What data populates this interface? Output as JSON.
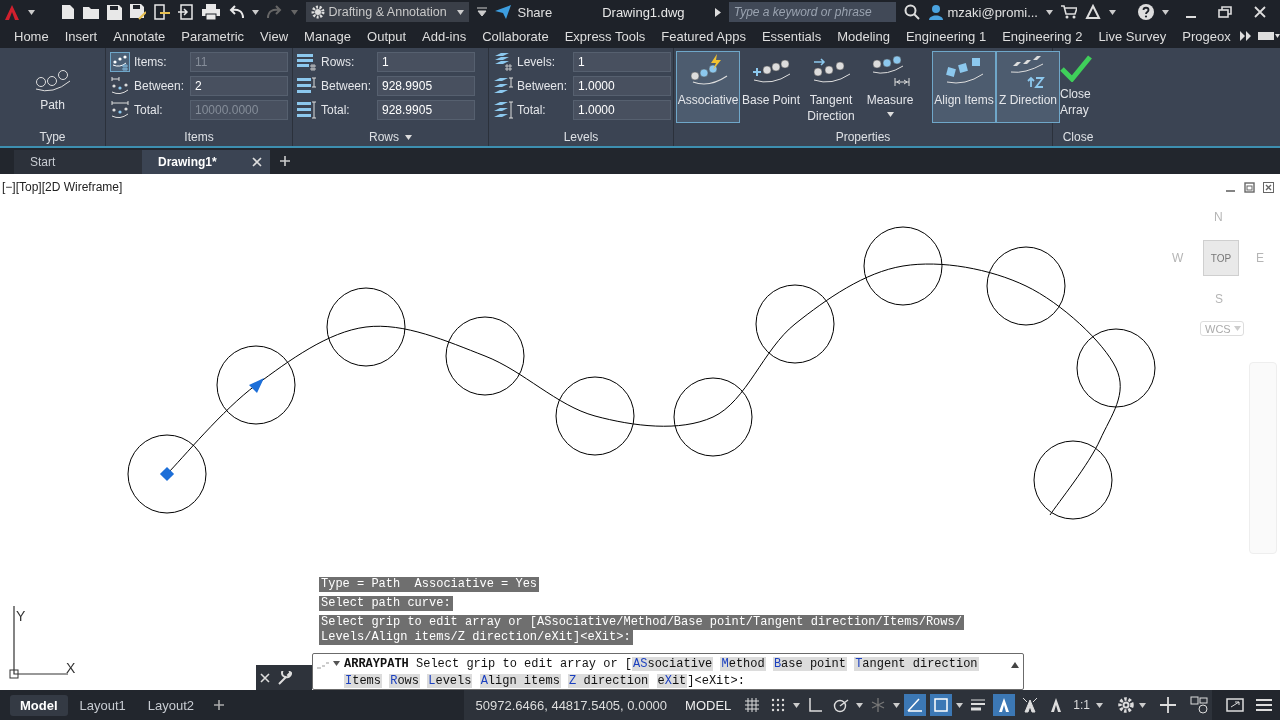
{
  "title_bar": {
    "workspace": "Drafting & Annotation",
    "share": "Share",
    "file": "Drawing1.dwg",
    "search": {
      "placeholder": "Type a keyword or phrase"
    },
    "user": "mzaki@promi..."
  },
  "menu_tabs": [
    "Home",
    "Insert",
    "Annotate",
    "Parametric",
    "View",
    "Manage",
    "Output",
    "Add-ins",
    "Collaborate",
    "Express Tools",
    "Featured Apps",
    "Essentials",
    "Modeling",
    "Engineering 1",
    "Engineering 2",
    "Live Survey",
    "Progeox"
  ],
  "ribbon": {
    "type_panel": {
      "button": "Path",
      "title": "Type"
    },
    "items_panel": {
      "title": "Items",
      "fields": [
        {
          "label": "Items:",
          "value": "11",
          "disabled": true
        },
        {
          "label": "Between:",
          "value": "2",
          "disabled": false
        },
        {
          "label": "Total:",
          "value": "10000.0000",
          "disabled": true
        }
      ]
    },
    "rows_panel": {
      "title": "Rows",
      "fields": [
        {
          "label": "Rows:",
          "value": "1"
        },
        {
          "label": "Between:",
          "value": "928.9905"
        },
        {
          "label": "Total:",
          "value": "928.9905"
        }
      ]
    },
    "levels_panel": {
      "title": "Levels",
      "fields": [
        {
          "label": "Levels:",
          "value": "1"
        },
        {
          "label": "Between:",
          "value": "1.0000"
        },
        {
          "label": "Total:",
          "value": "1.0000"
        }
      ]
    },
    "properties_panel": {
      "title": "Properties",
      "buttons": [
        {
          "kind": "associative",
          "label": "Associative",
          "selected": true
        },
        {
          "kind": "base_point",
          "label": "Base Point",
          "selected": false
        },
        {
          "kind": "tangent",
          "label": "Tangent Direction",
          "selected": false
        },
        {
          "kind": "measure",
          "label": "Measure",
          "selected": false
        },
        {
          "kind": "align",
          "label": "Align Items",
          "selected": true
        },
        {
          "kind": "z_direction",
          "label": "Z Direction",
          "selected": true
        }
      ]
    },
    "close_panel": {
      "title": "Close",
      "button": "Close Array"
    }
  },
  "doc_tabs": [
    {
      "label": "Start",
      "selected": false
    },
    {
      "label": "Drawing1*",
      "selected": true
    }
  ],
  "viewport": {
    "label": "[−][Top][2D Wireframe]",
    "viewcube": {
      "north": "N",
      "west": "W",
      "face": "TOP",
      "east": "E",
      "south": "S",
      "ucs": "WCS"
    },
    "ucs_icon": {
      "y": "Y",
      "x": "X"
    }
  },
  "command": {
    "history": [
      [
        "Type = Path  Associative = Yes"
      ],
      [
        "Select path curve:"
      ],
      [
        "Select grip to edit array or [ASsociative/Method/Base point/Tangent direction/Items/Rows/",
        "Levels/Align items/Z direction/eXit]<eXit>:"
      ]
    ],
    "name": "ARRAYPATH",
    "prompt": "Select grip to edit array or [",
    "options": [
      {
        "key": "AS",
        "post": "sociative"
      },
      {
        "key": "M",
        "post": "ethod"
      },
      {
        "key": "B",
        "post": "ase point"
      },
      {
        "key": "T",
        "post": "angent direction"
      },
      {
        "key": "I",
        "post": "tems"
      },
      {
        "key": "R",
        "post": "ows"
      },
      {
        "key": "L",
        "post": "evels"
      },
      {
        "key": "A",
        "post": "lign items"
      },
      {
        "key": "Z",
        "post": " direction"
      },
      {
        "pre": "e",
        "key": "X",
        "post": "it"
      }
    ],
    "tail": "]<eXit>:"
  },
  "status_bar": {
    "layouts": [
      {
        "label": "Model",
        "selected": true
      },
      {
        "label": "Layout1",
        "selected": false
      },
      {
        "label": "Layout2",
        "selected": false
      }
    ],
    "coordinates": "50972.6466, 44817.5405, 0.0000",
    "space": "MODEL",
    "toggles": [
      {
        "kind": "grid",
        "on": false
      },
      {
        "kind": "snap",
        "on": false
      },
      {
        "kind": "ortho",
        "on": false
      },
      {
        "kind": "polar",
        "on": false
      },
      {
        "kind": "isodraft",
        "on": false
      },
      {
        "kind": "tracking",
        "on": true
      },
      {
        "kind": "osnap",
        "on": true
      },
      {
        "kind": "lineweight",
        "on": false
      },
      {
        "kind": "annotation_visibility",
        "on": true
      },
      {
        "kind": "autoscale",
        "on": false
      },
      {
        "kind": "annotation_scale",
        "on": false
      }
    ],
    "scale": "1:1"
  }
}
